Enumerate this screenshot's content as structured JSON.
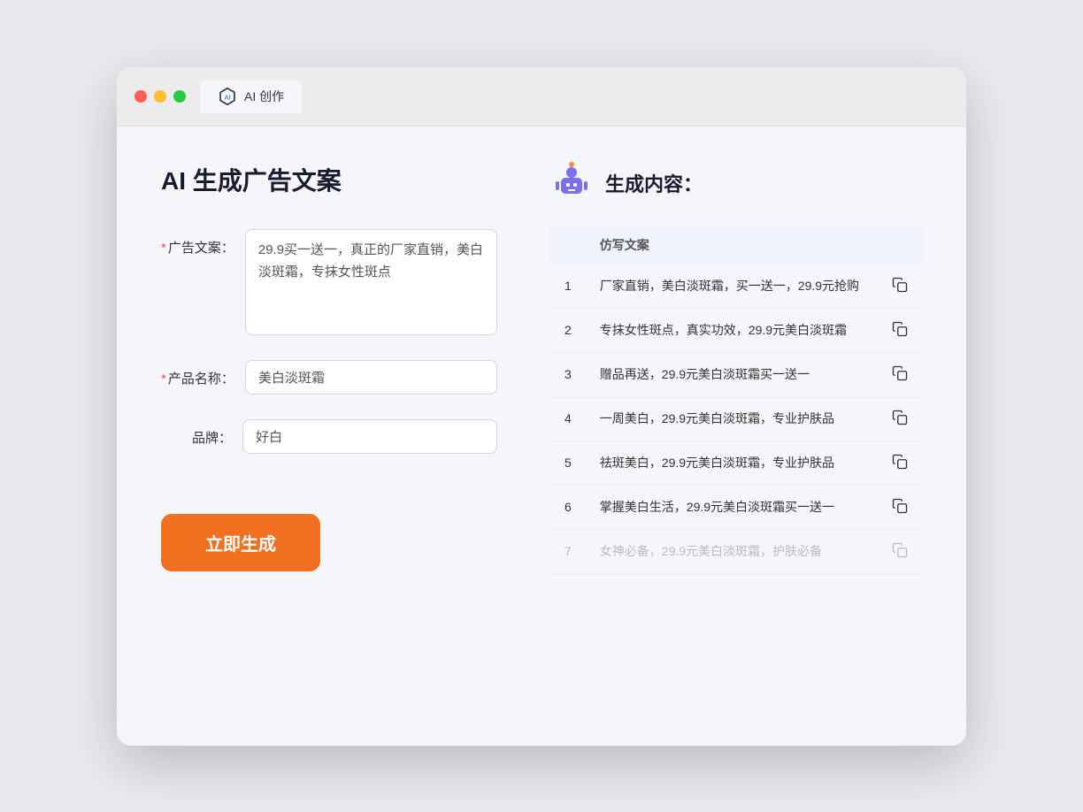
{
  "browser": {
    "tab_label": "AI 创作"
  },
  "page": {
    "title": "AI 生成广告文案",
    "result_heading": "生成内容："
  },
  "form": {
    "ad_copy_label": "广告文案：",
    "ad_copy_required": true,
    "ad_copy_value": "29.9买一送一，真正的厂家直销，美白淡斑霜，专抹女性斑点",
    "product_name_label": "产品名称：",
    "product_name_required": true,
    "product_name_value": "美白淡斑霜",
    "brand_label": "品牌：",
    "brand_required": false,
    "brand_value": "好白",
    "generate_btn": "立即生成"
  },
  "results": {
    "col_header": "仿写文案",
    "items": [
      {
        "num": 1,
        "text": "厂家直销，美白淡斑霜，买一送一，29.9元抢购",
        "faded": false
      },
      {
        "num": 2,
        "text": "专抹女性斑点，真实功效，29.9元美白淡斑霜",
        "faded": false
      },
      {
        "num": 3,
        "text": "赠品再送，29.9元美白淡斑霜买一送一",
        "faded": false
      },
      {
        "num": 4,
        "text": "一周美白，29.9元美白淡斑霜，专业护肤品",
        "faded": false
      },
      {
        "num": 5,
        "text": "祛斑美白，29.9元美白淡斑霜，专业护肤品",
        "faded": false
      },
      {
        "num": 6,
        "text": "掌握美白生活，29.9元美白淡斑霜买一送一",
        "faded": false
      },
      {
        "num": 7,
        "text": "女神必备，29.9元美白淡斑霜，护肤必备",
        "faded": true
      }
    ]
  }
}
